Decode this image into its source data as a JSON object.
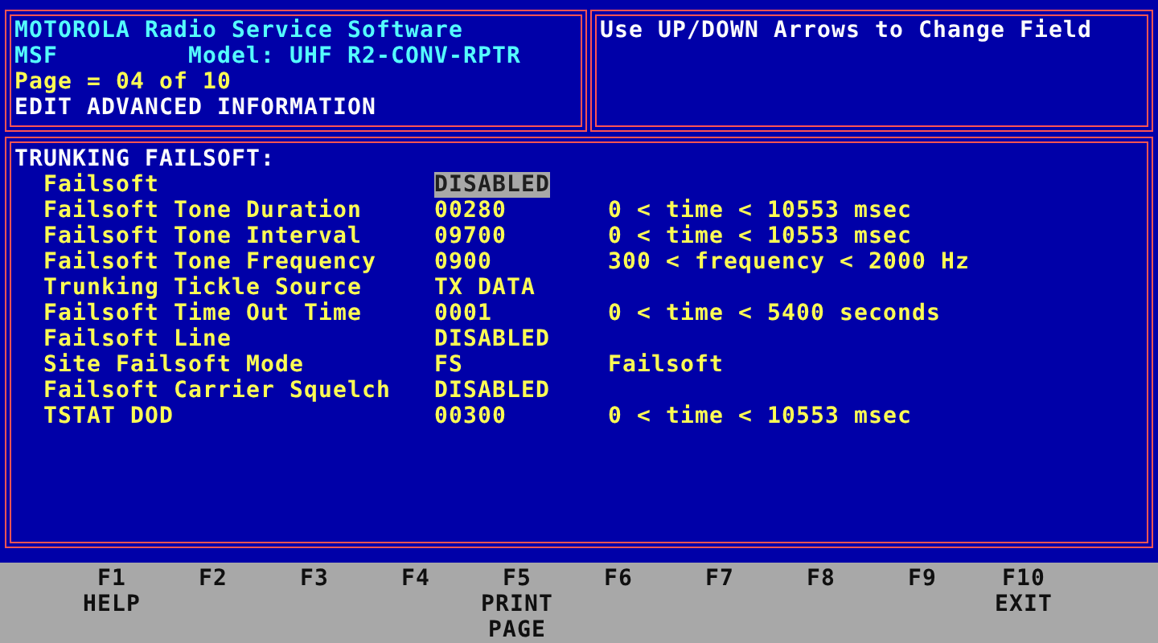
{
  "header": {
    "title": "MOTOROLA Radio Service Software",
    "program": "MSF",
    "model": "Model: UHF R2-CONV-RPTR",
    "page": "Page = 04 of 10",
    "mode": "EDIT ADVANCED INFORMATION"
  },
  "hint": "Use UP/DOWN Arrows to Change Field",
  "section": "TRUNKING FAILSOFT:",
  "fields": [
    {
      "label": "Failsoft",
      "value": "DISABLED",
      "selected": true
    },
    {
      "label": "Failsoft Tone Duration",
      "value": "00280",
      "range": "0 < time < 10553 msec",
      "selected": false
    },
    {
      "label": "Failsoft Tone Interval",
      "value": "09700",
      "range": "0 < time < 10553 msec",
      "selected": false
    },
    {
      "label": "Failsoft Tone Frequency",
      "value": "0900",
      "range": "300 < frequency < 2000 Hz",
      "selected": false
    },
    {
      "label": "Trunking Tickle Source",
      "value": "TX DATA",
      "selected": false
    },
    {
      "label": "Failsoft Time Out Time",
      "value": "0001",
      "range": "0 < time < 5400 seconds",
      "selected": false
    },
    {
      "label": "Failsoft Line",
      "value": "DISABLED",
      "selected": false
    },
    {
      "label": "Site Failsoft Mode",
      "value": "FS",
      "range": "Failsoft",
      "selected": false
    },
    {
      "label": "Failsoft Carrier Squelch",
      "value": "DISABLED",
      "selected": false
    },
    {
      "label": "TSTAT DOD",
      "value": "00300",
      "range": "0 < time < 10553 msec",
      "selected": false
    }
  ],
  "function_keys": [
    {
      "key": "F1",
      "label": "HELP"
    },
    {
      "key": "F2"
    },
    {
      "key": "F3"
    },
    {
      "key": "F4"
    },
    {
      "key": "F5",
      "label": "PRINT PAGE"
    },
    {
      "key": "F6"
    },
    {
      "key": "F7"
    },
    {
      "key": "F8"
    },
    {
      "key": "F9"
    },
    {
      "key": "F10",
      "label": "EXIT"
    }
  ]
}
